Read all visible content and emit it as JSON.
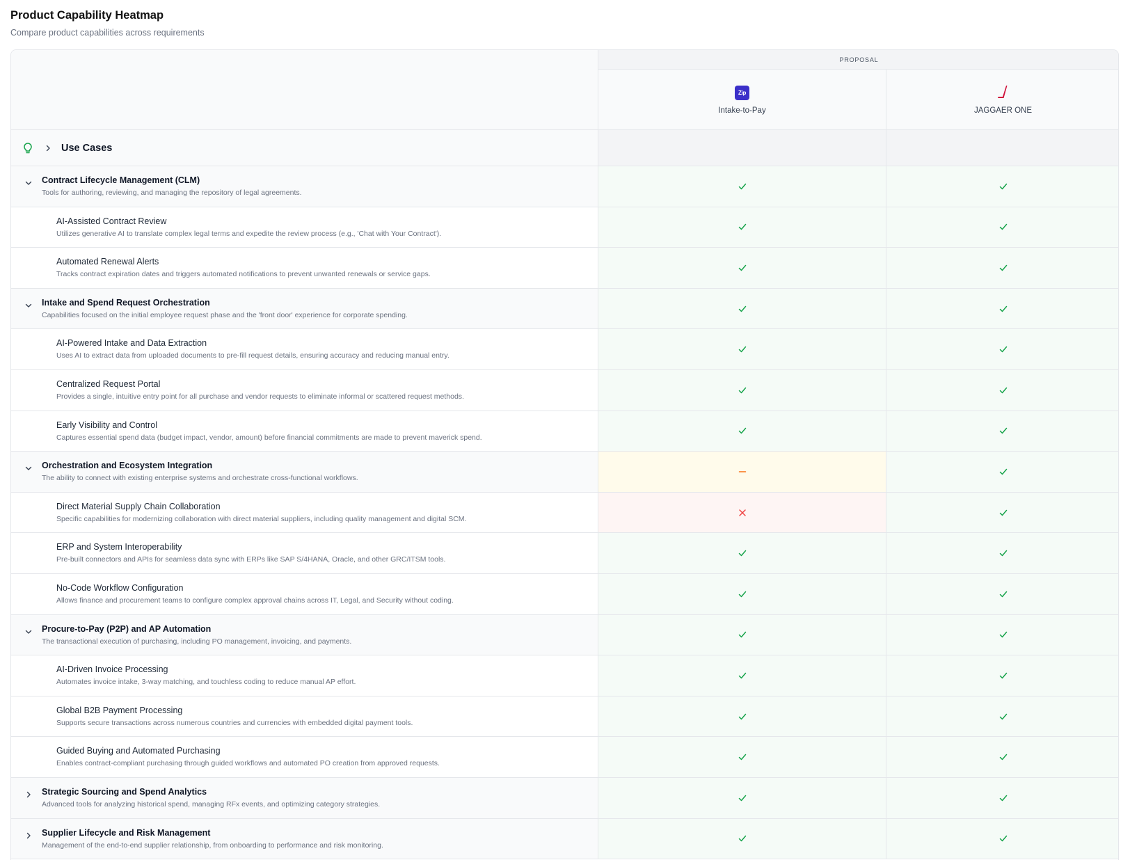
{
  "page": {
    "title": "Product Capability Heatmap",
    "subtitle": "Compare product capabilities across requirements"
  },
  "header": {
    "group_label": "PROPOSAL",
    "products": [
      {
        "name": "Intake-to-Pay",
        "logo_text": "Zip",
        "logo_color": "#3b2fc9"
      },
      {
        "name": "JAGGAER ONE",
        "logo_icon": "jaggaer-slash-logo-icon",
        "logo_color": "#d0103a"
      }
    ]
  },
  "use_cases": {
    "label": "Use Cases",
    "icon": "lightbulb-icon",
    "icon_color": "#16a34a"
  },
  "status_colors": {
    "yes": "#16a34a",
    "partial": "#f97316",
    "no": "#ef4444"
  },
  "rows": [
    {
      "type": "category",
      "expanded": true,
      "name": "Contract Lifecycle Management (CLM)",
      "desc": "Tools for authoring, reviewing, and managing the repository of legal agreements.",
      "status": [
        "yes",
        "yes"
      ]
    },
    {
      "type": "sub",
      "name": "AI-Assisted Contract Review",
      "desc": "Utilizes generative AI to translate complex legal terms and expedite the review process (e.g., 'Chat with Your Contract').",
      "status": [
        "yes",
        "yes"
      ]
    },
    {
      "type": "sub",
      "name": "Automated Renewal Alerts",
      "desc": "Tracks contract expiration dates and triggers automated notifications to prevent unwanted renewals or service gaps.",
      "status": [
        "yes",
        "yes"
      ]
    },
    {
      "type": "category",
      "expanded": true,
      "name": "Intake and Spend Request Orchestration",
      "desc": "Capabilities focused on the initial employee request phase and the 'front door' experience for corporate spending.",
      "status": [
        "yes",
        "yes"
      ]
    },
    {
      "type": "sub",
      "name": "AI-Powered Intake and Data Extraction",
      "desc": "Uses AI to extract data from uploaded documents to pre-fill request details, ensuring accuracy and reducing manual entry.",
      "status": [
        "yes",
        "yes"
      ]
    },
    {
      "type": "sub",
      "name": "Centralized Request Portal",
      "desc": "Provides a single, intuitive entry point for all purchase and vendor requests to eliminate informal or scattered request methods.",
      "status": [
        "yes",
        "yes"
      ]
    },
    {
      "type": "sub",
      "name": "Early Visibility and Control",
      "desc": "Captures essential spend data (budget impact, vendor, amount) before financial commitments are made to prevent maverick spend.",
      "status": [
        "yes",
        "yes"
      ]
    },
    {
      "type": "category",
      "expanded": true,
      "name": "Orchestration and Ecosystem Integration",
      "desc": "The ability to connect with existing enterprise systems and orchestrate cross-functional workflows.",
      "status": [
        "partial",
        "yes"
      ]
    },
    {
      "type": "sub",
      "name": "Direct Material Supply Chain Collaboration",
      "desc": "Specific capabilities for modernizing collaboration with direct material suppliers, including quality management and digital SCM.",
      "status": [
        "no",
        "yes"
      ]
    },
    {
      "type": "sub",
      "name": "ERP and System Interoperability",
      "desc": "Pre-built connectors and APIs for seamless data sync with ERPs like SAP S/4HANA, Oracle, and other GRC/ITSM tools.",
      "status": [
        "yes",
        "yes"
      ]
    },
    {
      "type": "sub",
      "name": "No-Code Workflow Configuration",
      "desc": "Allows finance and procurement teams to configure complex approval chains across IT, Legal, and Security without coding.",
      "status": [
        "yes",
        "yes"
      ]
    },
    {
      "type": "category",
      "expanded": true,
      "name": "Procure-to-Pay (P2P) and AP Automation",
      "desc": "The transactional execution of purchasing, including PO management, invoicing, and payments.",
      "status": [
        "yes",
        "yes"
      ]
    },
    {
      "type": "sub",
      "name": "AI-Driven Invoice Processing",
      "desc": "Automates invoice intake, 3-way matching, and touchless coding to reduce manual AP effort.",
      "status": [
        "yes",
        "yes"
      ]
    },
    {
      "type": "sub",
      "name": "Global B2B Payment Processing",
      "desc": "Supports secure transactions across numerous countries and currencies with embedded digital payment tools.",
      "status": [
        "yes",
        "yes"
      ]
    },
    {
      "type": "sub",
      "name": "Guided Buying and Automated Purchasing",
      "desc": "Enables contract-compliant purchasing through guided workflows and automated PO creation from approved requests.",
      "status": [
        "yes",
        "yes"
      ]
    },
    {
      "type": "category",
      "expanded": false,
      "name": "Strategic Sourcing and Spend Analytics",
      "desc": "Advanced tools for analyzing historical spend, managing RFx events, and optimizing category strategies.",
      "status": [
        "yes",
        "yes"
      ]
    },
    {
      "type": "category",
      "expanded": false,
      "name": "Supplier Lifecycle and Risk Management",
      "desc": "Management of the end-to-end supplier relationship, from onboarding to performance and risk monitoring.",
      "status": [
        "yes",
        "yes"
      ]
    }
  ]
}
